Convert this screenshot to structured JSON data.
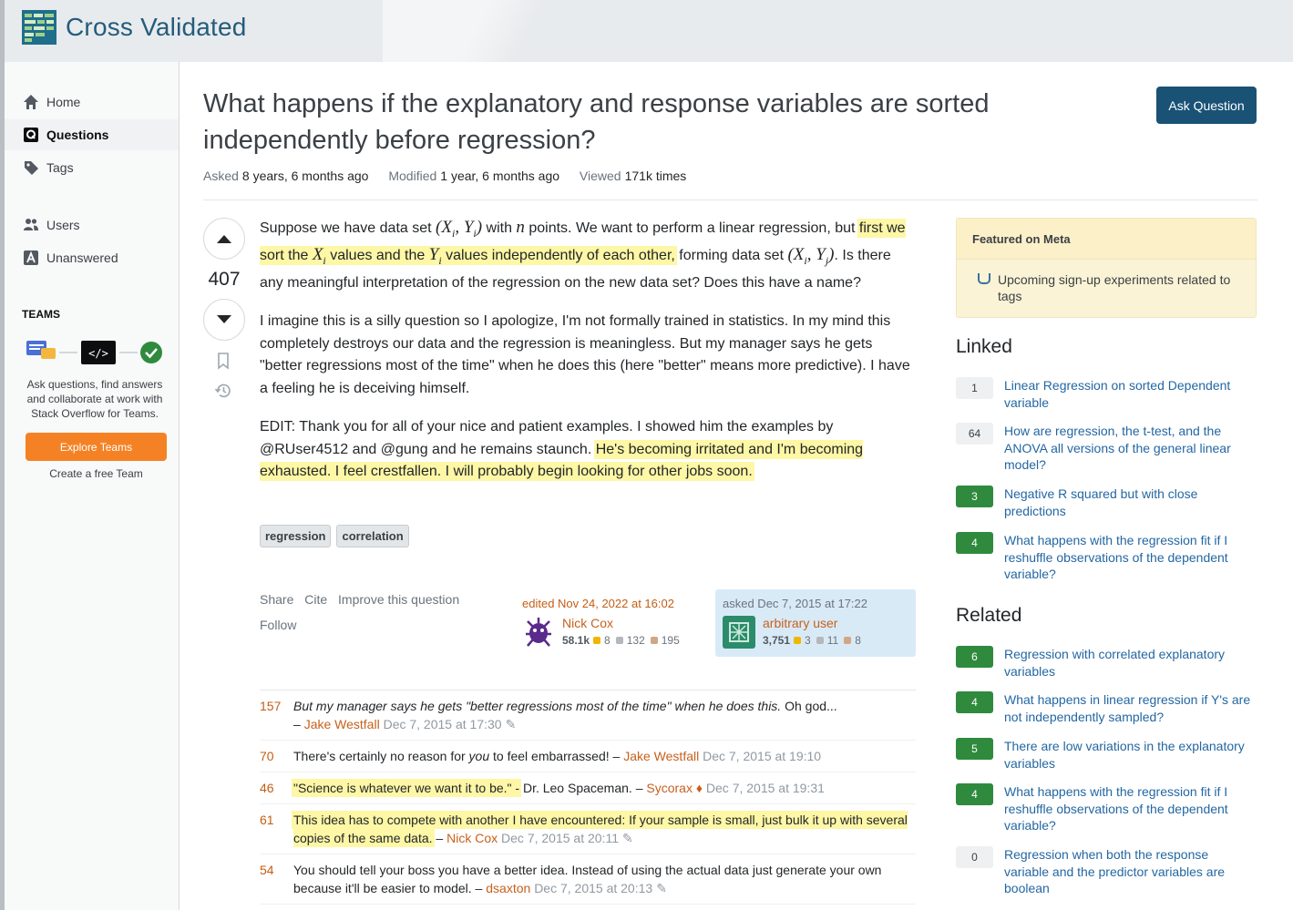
{
  "site": {
    "name": "Cross Validated"
  },
  "sidebar": {
    "items": [
      {
        "label": "Home",
        "icon": "home-icon"
      },
      {
        "label": "Questions",
        "icon": "questions-icon"
      },
      {
        "label": "Tags",
        "icon": "tag-icon"
      },
      {
        "label": "Users",
        "icon": "users-icon"
      },
      {
        "label": "Unanswered",
        "icon": "unanswered-icon"
      }
    ],
    "teams_heading": "TEAMS",
    "teams_text": "Ask questions, find answers and collaborate at work with Stack Overflow for Teams.",
    "explore_button": "Explore Teams",
    "free_team": "Create a free Team"
  },
  "question": {
    "title": "What happens if the explanatory and response variables are sorted independently before regression?",
    "ask_button": "Ask Question",
    "asked_label": "Asked",
    "asked_value": "8 years, 6 months ago",
    "modified_label": "Modified",
    "modified_value": "1 year, 6 months ago",
    "viewed_label": "Viewed",
    "viewed_value": "171k times",
    "score": "407",
    "body": {
      "p1_a": "Suppose we have data set ",
      "p1_b": " with ",
      "p1_c": " points. We want to perform a linear regression, but ",
      "p1_hl_a": "first we sort the ",
      "p1_hl_b": " values and the ",
      "p1_hl_c": " values independently of each other,",
      "p1_d": " forming data set ",
      "p1_e": ". Is there any meaningful interpretation of the regression on the new data set? Does this have a name?",
      "p2": "I imagine this is a silly question so I apologize, I'm not formally trained in statistics. In my mind this completely destroys our data and the regression is meaningless. But my manager says he gets \"better regressions most of the time\" when he does this (here \"better\" means more predictive). I have a feeling he is deceiving himself.",
      "p3_a": "EDIT: Thank you for all of your nice and patient examples. I showed him the examples by @RUser4512 and @gung and he remains staunch. ",
      "p3_hl": "He's becoming irritated and I'm becoming exhausted. I feel crestfallen. I will probably begin looking for other jobs soon."
    },
    "tags": [
      "regression",
      "correlation"
    ],
    "actions": {
      "share": "Share",
      "cite": "Cite",
      "improve": "Improve this question",
      "follow": "Follow"
    },
    "editor": {
      "when": "edited Nov 24, 2022 at 16:02",
      "name": "Nick Cox",
      "rep": "58.1k",
      "gold": "8",
      "silver": "132",
      "bronze": "195"
    },
    "asker": {
      "when": "asked Dec 7, 2015 at 17:22",
      "name": "arbitrary user",
      "rep": "3,751",
      "gold": "3",
      "silver": "11",
      "bronze": "8"
    }
  },
  "comments": [
    {
      "score": "157",
      "text_italic": "But my manager says he gets \"better regressions most of the time\" when he does this.",
      "text": " Oh god...",
      "sep": "– ",
      "user": "Jake Westfall",
      "date": "Dec 7, 2015 at 17:30",
      "edited": true
    },
    {
      "score": "70",
      "text_a": "There's certainly no reason for ",
      "text_em": "you",
      "text_b": " to feel embarrassed!",
      "sep": " – ",
      "user": "Jake Westfall",
      "date": "Dec 7, 2015 at 19:10",
      "edited": false
    },
    {
      "score": "46",
      "text_hl": "\"Science is whatever we want it to be.\" -",
      "text": " Dr. Leo Spaceman.",
      "sep": " – ",
      "user": "Sycorax",
      "mod": "♦",
      "date": "Dec 7, 2015 at 19:31",
      "edited": false
    },
    {
      "score": "61",
      "text_hl": "This idea has to compete with another I have encountered: If your sample is small, just bulk it up with several copies of the same data.",
      "sep": " – ",
      "user": "Nick Cox",
      "date": "Dec 7, 2015 at 20:11",
      "edited": true
    },
    {
      "score": "54",
      "text": "You should tell your boss you have a better idea. Instead of using the actual data just generate your own because it'll be easier to model.",
      "sep": " – ",
      "user": "dsaxton",
      "date": "Dec 7, 2015 at 20:13",
      "edited": true
    }
  ],
  "featured": {
    "heading": "Featured on Meta",
    "item": "Upcoming sign-up experiments related to tags"
  },
  "linked": {
    "heading": "Linked",
    "items": [
      {
        "count": "1",
        "answered": false,
        "title": "Linear Regression on sorted Dependent variable"
      },
      {
        "count": "64",
        "answered": false,
        "title": "How are regression, the t-test, and the ANOVA all versions of the general linear model?"
      },
      {
        "count": "3",
        "answered": true,
        "title": "Negative R squared but with close predictions"
      },
      {
        "count": "4",
        "answered": true,
        "title": "What happens with the regression fit if I reshuffle observations of the dependent variable?"
      }
    ]
  },
  "related": {
    "heading": "Related",
    "items": [
      {
        "count": "6",
        "answered": true,
        "title": "Regression with correlated explanatory variables"
      },
      {
        "count": "4",
        "answered": true,
        "title": "What happens in linear regression if Y's are not independently sampled?"
      },
      {
        "count": "5",
        "answered": true,
        "title": "There are low variations in the explanatory variables"
      },
      {
        "count": "4",
        "answered": true,
        "title": "What happens with the regression fit if I reshuffle observations of the dependent variable?"
      },
      {
        "count": "0",
        "answered": false,
        "title": "Regression when both the response variable and the predictor variables are boolean"
      }
    ]
  },
  "colors": {
    "accent": "#f48225",
    "link": "#2367a2",
    "answered": "#2f8a3e",
    "highlight": "#fdf7a6"
  }
}
